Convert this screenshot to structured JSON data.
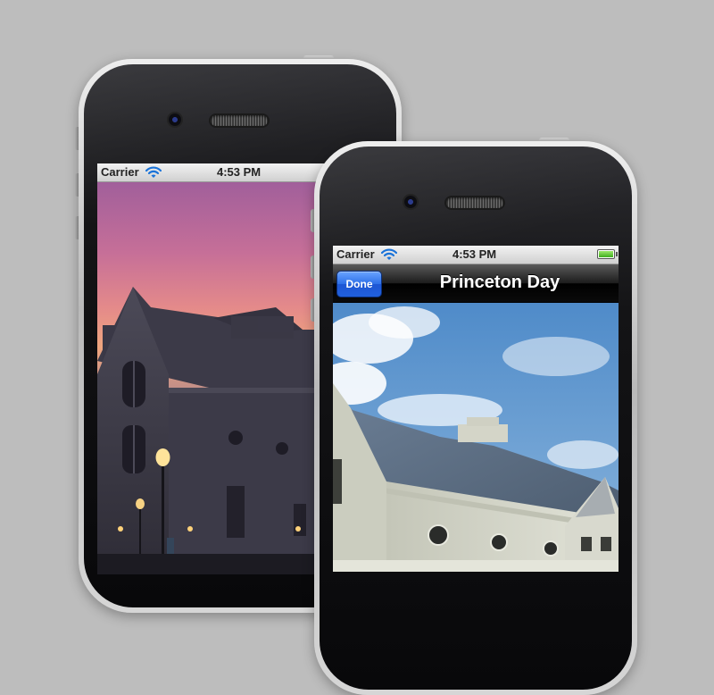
{
  "back_phone": {
    "status_bar": {
      "carrier": "Carrier",
      "time": "4:53 PM"
    },
    "photo": {
      "subject": "chapel at dusk"
    }
  },
  "front_phone": {
    "status_bar": {
      "carrier": "Carrier",
      "time": "4:53 PM"
    },
    "nav_bar": {
      "done_label": "Done",
      "title": "Princeton Day"
    },
    "photo": {
      "subject": "chapel in daylight"
    }
  },
  "icons": [
    "wifi-icon",
    "battery-icon",
    "camera-lens-icon",
    "speaker-grille-icon"
  ],
  "colors": {
    "background": "#bdbdbd",
    "done_button": "#2d6fe8",
    "nav_bar": "#000000"
  }
}
